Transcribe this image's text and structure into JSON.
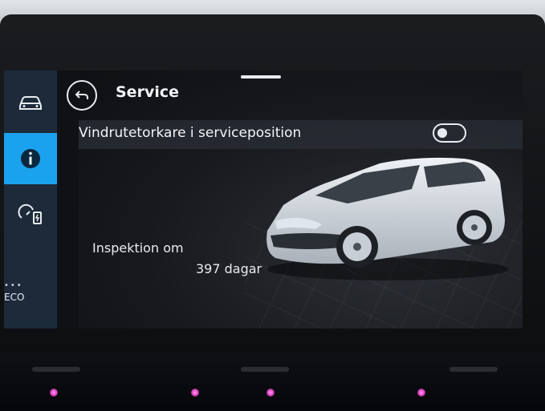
{
  "header": {
    "title": "Service",
    "back_icon": "back-arrow-icon"
  },
  "sidebar": {
    "items": [
      {
        "icon": "car-icon",
        "active": false
      },
      {
        "icon": "info-icon",
        "active": true
      },
      {
        "icon": "charging-icon",
        "active": false
      }
    ],
    "eco_label": "ECO"
  },
  "settings": {
    "wiper_label": "Vindrutetorkare i serviceposition",
    "wiper_toggle_on": false
  },
  "inspection": {
    "label": "Inspektion om",
    "value": "397 dagar"
  },
  "colors": {
    "accent": "#1aa2ee",
    "sidebar": "#1c2a3a",
    "background": "#17191d"
  }
}
